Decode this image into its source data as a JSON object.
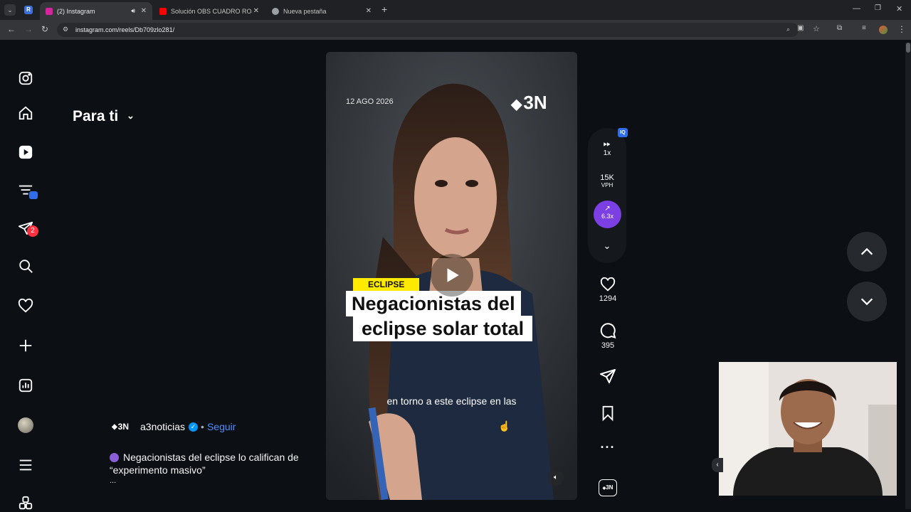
{
  "browser": {
    "tabs": [
      {
        "label": "(2) Instagram",
        "active": true
      },
      {
        "label": "Solución OBS CUADRO ROJO a",
        "active": false
      },
      {
        "label": "Nueva pestaña",
        "active": false
      }
    ],
    "url": "instagram.com/reels/Db709zlo281/"
  },
  "page": {
    "feed_title": "Para ti",
    "messages_badge": "2"
  },
  "video": {
    "date_stamp": "12 AGO 2026",
    "channel_logo": "3N",
    "tag": "ECLIPSE",
    "headline_line1": "Negacionistas del",
    "headline_line2": "eclipse solar total",
    "subtitle": "en torno a este eclipse en las"
  },
  "author": {
    "logo": "3N",
    "username": "a3noticias",
    "separator": "•",
    "follow_label": "Seguir",
    "caption_line1": "Negacionistas del eclipse lo califican de",
    "caption_line2": "“experimento masivo”",
    "more": "..."
  },
  "extension_rail": {
    "speed": "1x",
    "views_count": "15K",
    "views_unit": "VPH",
    "trend_value": "6.3x"
  },
  "actions": {
    "likes": "1294",
    "comments": "395"
  }
}
